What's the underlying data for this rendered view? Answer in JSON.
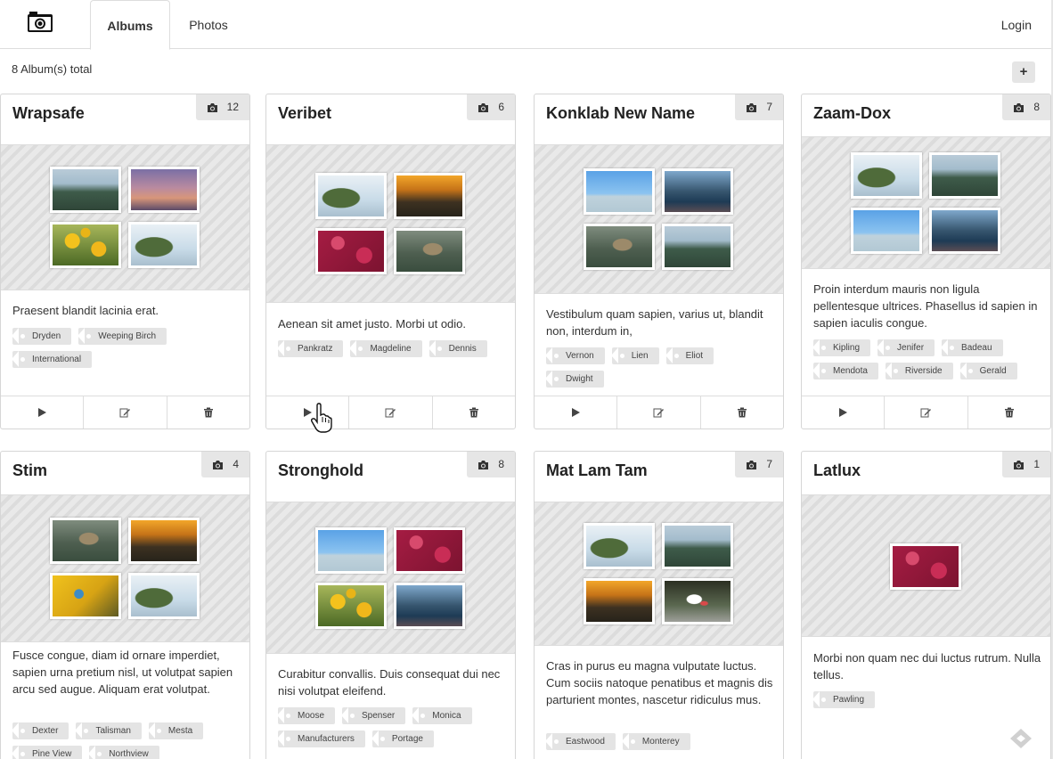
{
  "nav": {
    "logo_icon": "camera-icon",
    "tabs": [
      {
        "label": "Albums",
        "active": true
      },
      {
        "label": "Photos",
        "active": false
      }
    ],
    "login_label": "Login"
  },
  "toolbar": {
    "total_text": "8 Album(s) total",
    "add_label": "+"
  },
  "albums": [
    {
      "title": "Wrapsafe",
      "count": "12",
      "thumbs": [
        "mount",
        "dusk",
        "sunflower",
        "tree"
      ],
      "description": "Praesent blandit lacinia erat.",
      "tags": [
        "Dryden",
        "Weeping Birch",
        "International"
      ]
    },
    {
      "title": "Veribet",
      "count": "6",
      "thumbs": [
        "tree",
        "sunset",
        "flowers",
        "deer"
      ],
      "description": "Aenean sit amet justo. Morbi ut odio.",
      "tags": [
        "Pankratz",
        "Magdeline",
        "Dennis"
      ]
    },
    {
      "title": "Konklab New Name",
      "count": "7",
      "thumbs": [
        "legs",
        "blue",
        "deer",
        "mount"
      ],
      "description": "Vestibulum quam sapien, varius ut, blandit non, interdum in,",
      "tags": [
        "Vernon",
        "Lien",
        "Eliot",
        "Dwight"
      ]
    },
    {
      "title": "Zaam-Dox",
      "count": "8",
      "thumbs": [
        "tree",
        "mount",
        "legs",
        "blue"
      ],
      "description": "Proin interdum mauris non ligula pellentesque ultrices. Phasellus id sapien in sapien iaculis congue.",
      "tags": [
        "Kipling",
        "Jenifer",
        "Badeau",
        "Mendota",
        "Riverside",
        "Gerald"
      ]
    },
    {
      "title": "Stim",
      "count": "4",
      "thumbs": [
        "deer",
        "sunset",
        "yellowflower",
        "tree"
      ],
      "description": "Fusce congue, diam id ornare imperdiet, sapien urna pretium nisl, ut volutpat sapien arcu sed augue. Aliquam erat volutpat.",
      "tags": [
        "Dexter",
        "Talisman",
        "Mesta",
        "Pine View",
        "Northview"
      ]
    },
    {
      "title": "Stronghold",
      "count": "8",
      "thumbs": [
        "legs",
        "flowers",
        "sunflower",
        "blue"
      ],
      "description": "Curabitur convallis. Duis consequat dui nec nisi volutpat eleifend.",
      "tags": [
        "Moose",
        "Spenser",
        "Monica",
        "Manufacturers",
        "Portage"
      ]
    },
    {
      "title": "Mat Lam Tam",
      "count": "7",
      "thumbs": [
        "tree",
        "mount",
        "sunset",
        "shoes"
      ],
      "description": "Cras in purus eu magna vulputate luctus. Cum sociis natoque penatibus et magnis dis parturient montes, nascetur ridiculus mus.",
      "tags": [
        "Eastwood",
        "Monterey"
      ]
    },
    {
      "title": "Latlux",
      "count": "1",
      "thumbs": [
        "flowers"
      ],
      "description": "Morbi non quam nec dui luctus rutrum. Nulla tellus.",
      "tags": [
        "Pawling"
      ]
    }
  ],
  "card_actions": [
    {
      "name": "play-button",
      "icon": "play-icon"
    },
    {
      "name": "edit-button",
      "icon": "edit-icon"
    },
    {
      "name": "delete-button",
      "icon": "trash-icon"
    }
  ]
}
